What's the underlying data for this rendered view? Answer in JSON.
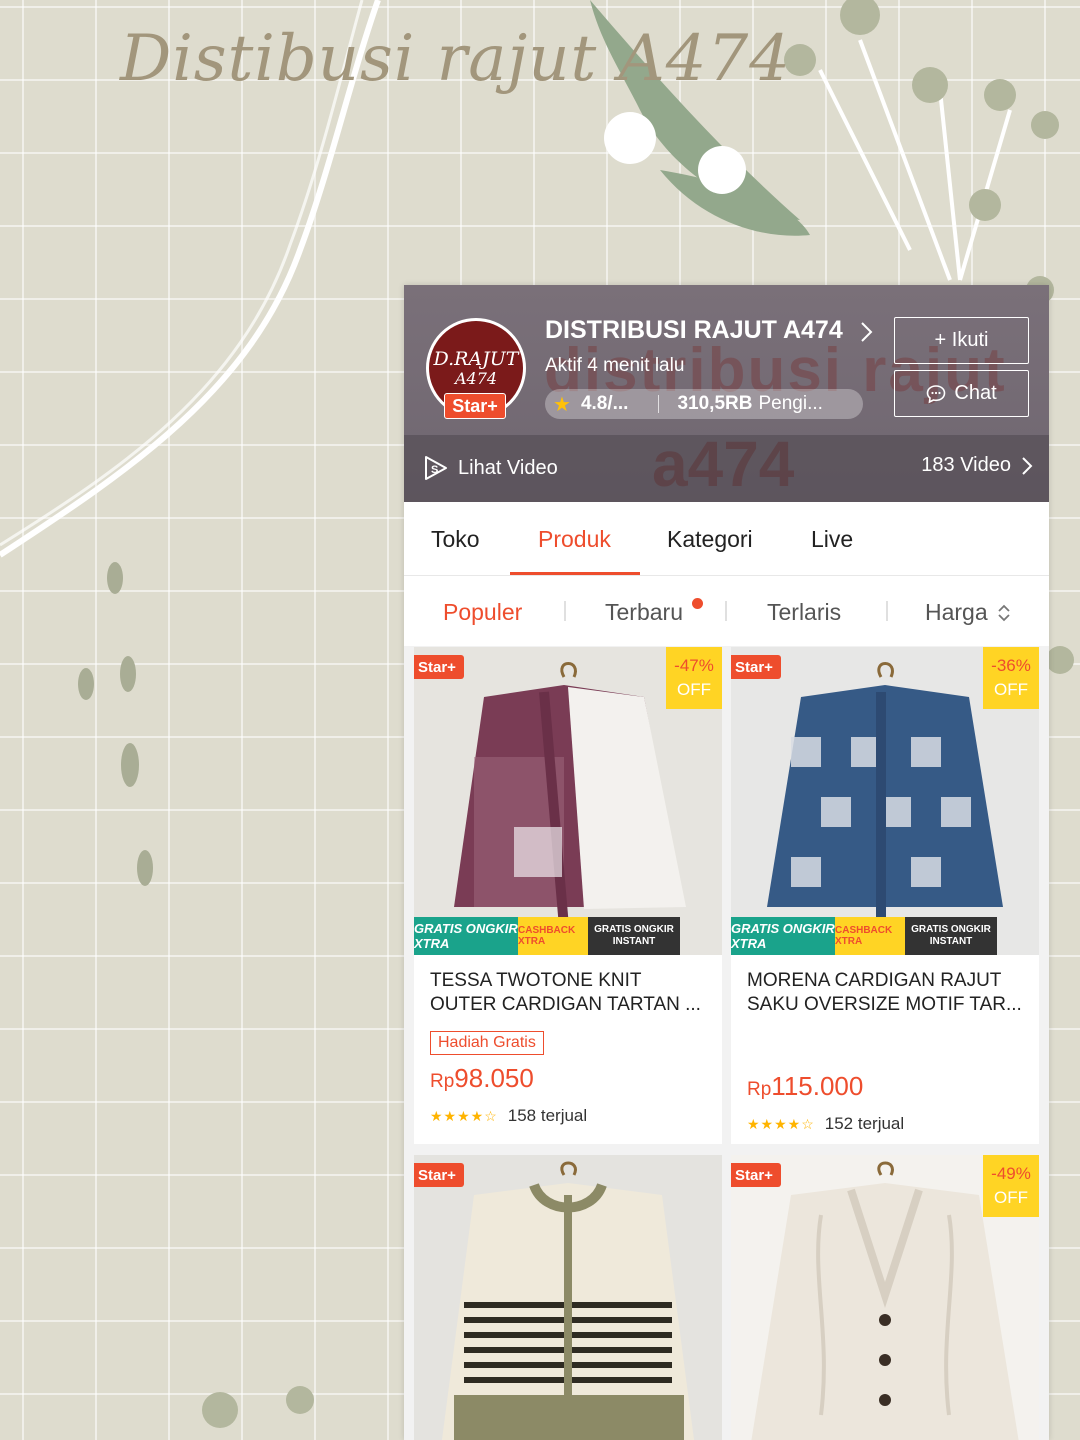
{
  "overlay": {
    "title": "Distibusi rajut A474"
  },
  "shop": {
    "logo_line1": "D.RAJUT",
    "logo_line2": "A474",
    "star_badge": "Star+",
    "name": "DISTRIBUSI RAJUT A474",
    "active": "Aktif 4 menit lalu",
    "rating": "4.8/...",
    "followers": "310,5RB",
    "followers_suffix": "Pengi...",
    "follow_button": "+ Ikuti",
    "chat_button": "Chat",
    "banner_text": "distribusi rajut",
    "banner_text2": "a474",
    "video_label": "Lihat Video",
    "video_count": "183 Video"
  },
  "tabs": [
    "Toko",
    "Produk",
    "Kategori",
    "Live"
  ],
  "active_tab": "Produk",
  "sort": [
    "Populer",
    "Terbaru",
    "Terlaris",
    "Harga"
  ],
  "active_sort": "Populer",
  "products": [
    {
      "badge": "Star+",
      "discount": "-47%",
      "discount_off": "OFF",
      "promo": [
        "GRATIS ONGKIR XTRA",
        "CASHBACK XTRA",
        "GRATIS ONGKIR INSTANT"
      ],
      "title": "TESSA TWOTONE KNIT OUTER CARDIGAN TARTAN ...",
      "gift": "Hadiah Gratis",
      "currency": "Rp",
      "price": "98.050",
      "rating": 4.5,
      "sold": "158 terjual",
      "colors": [
        "#7a3c55",
        "#f3f1ee"
      ]
    },
    {
      "badge": "Star+",
      "discount": "-36%",
      "discount_off": "OFF",
      "promo": [
        "GRATIS ONGKIR XTRA",
        "CASHBACK XTRA",
        "GRATIS ONGKIR INSTANT"
      ],
      "title": "MORENA CARDIGAN RAJUT SAKU OVERSIZE MOTIF TAR...",
      "gift": "",
      "currency": "Rp",
      "price": "115.000",
      "rating": 4.5,
      "sold": "152 terjual",
      "colors": [
        "#365a86",
        "#d9dde4"
      ]
    },
    {
      "badge": "Star+",
      "discount": "",
      "discount_off": "",
      "title": "",
      "colors": [
        "#8c8a66",
        "#efe9da"
      ]
    },
    {
      "badge": "Star+",
      "discount": "-49%",
      "discount_off": "OFF",
      "title": "",
      "colors": [
        "#ece6dc",
        "#efe9da"
      ]
    }
  ],
  "accent_color": "#ee4d2d"
}
